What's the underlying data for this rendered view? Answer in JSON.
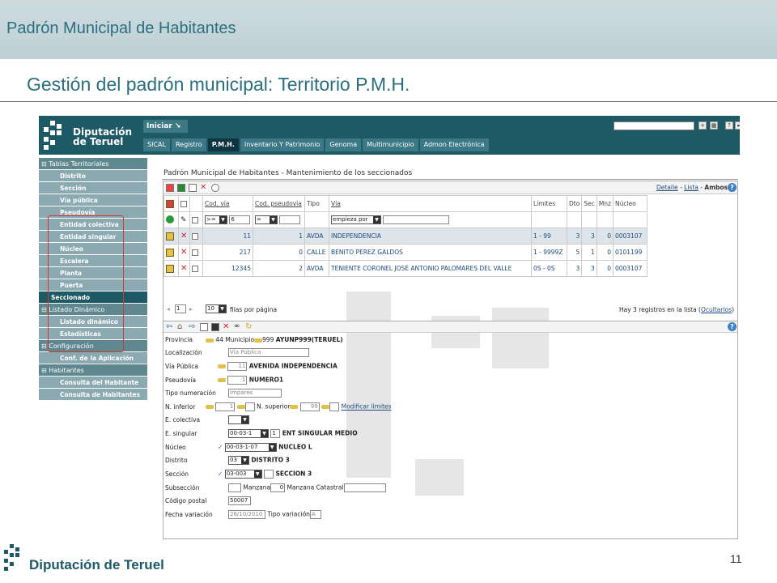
{
  "header": {
    "title": "Padrón Municipal de Habitantes"
  },
  "slide": {
    "title": "Gestión del padrón municipal: Territorio P.M.H.",
    "page_number": "11",
    "footer_brand": "Diputación de Teruel"
  },
  "app": {
    "logo_line1": "Diputación",
    "logo_line2": "de Teruel",
    "start_button": "Iniciar ↘",
    "tabs": [
      "SICAL",
      "Registro",
      "P.M.H.",
      "Inventario Y Patrimonio",
      "Genoma",
      "Multimunicipio",
      "Admon Electrónica"
    ],
    "active_tab": "P.M.H."
  },
  "sidebar": {
    "group1": "Tablas Territoriales",
    "items1": [
      "Distrito",
      "Sección",
      "Vía pública",
      "Pseudovía",
      "Entidad colectiva",
      "Entidad singular",
      "Núcleo",
      "Escalera",
      "Planta",
      "Puerta"
    ],
    "selected": "Seccionado",
    "group2": "Listado Dinámico",
    "items2": [
      "Listado dinámico",
      "Estadísticas"
    ],
    "group3": "Configuración",
    "items3": [
      "Conf. de la Aplicación"
    ],
    "group4": "Habitantes",
    "items4": [
      "Consulta del Habitante",
      "Consulta de Habitantes"
    ]
  },
  "panel": {
    "title": "Padrón Municipal de Habitantes - Mantenimiento de los seccionados",
    "views": {
      "detalle": "Detalle",
      "lista": "Lista",
      "ambos": "Ambos",
      "sep": "-"
    },
    "columns": {
      "cod_via": "Cod. vía",
      "cod_pseudovia": "Cod. pseudovía",
      "tipo": "Tipo",
      "via": "Vía",
      "limites": "Límites",
      "dto": "Dto",
      "sec": "Sec",
      "mnz": "Mnz",
      "nucleo": "Núcleo"
    },
    "filters": {
      "op1": ">=",
      "val1": "6",
      "op2": "=",
      "via_mode": "empieza por"
    },
    "rows": [
      {
        "cod_via": "11",
        "cod_pseudovia": "1",
        "tipo": "AVDA",
        "via": "INDEPENDENCIA",
        "limites": "1 - 99",
        "dto": "3",
        "sec": "3",
        "mnz": "0",
        "nucleo": "0003107"
      },
      {
        "cod_via": "217",
        "cod_pseudovia": "0",
        "tipo": "CALLE",
        "via": "BENITO PEREZ GALDOS",
        "limites": "1 - 9999Z",
        "dto": "5",
        "sec": "1",
        "mnz": "0",
        "nucleo": "0101199"
      },
      {
        "cod_via": "12345",
        "cod_pseudovia": "2",
        "tipo": "AVDA",
        "via": "TENIENTE CORONEL JOSÉ ANTONIO PALOMARES DEL VALLE",
        "limites": "0S - 0S",
        "dto": "3",
        "sec": "3",
        "mnz": "0",
        "nucleo": "0003107"
      }
    ],
    "pager": {
      "page": "1",
      "page_size": "10",
      "per_page_label": "filas por página",
      "count_text": "Hay 3 registros en la lista (",
      "hidden_link": "Ocultarlos",
      "count_close": ")"
    }
  },
  "form": {
    "provincia_label": "Provincia",
    "provincia_code": "44",
    "municipio_label": "Municipio",
    "municipio_code": "999",
    "municipio_name": "AYUNP999(TERUEL)",
    "localizacion_label": "Localización",
    "localizacion_value": "Vía Pública",
    "via_label": "Vía Pública",
    "via_code": "11",
    "via_name": "AVENIDA INDEPENDENCIA",
    "pseudovia_label": "Pseudovía",
    "pseudovia_code": "1",
    "pseudovia_name": "NUMERO1",
    "tiponum_label": "Tipo numeración",
    "tiponum_value": "Impares",
    "ninf_label": "N. inferior",
    "ninf_value": "1",
    "nsup_label": "N. superior",
    "nsup_value": "99",
    "mod_link": "Modificar límites",
    "ecol_label": "E. colectiva",
    "esing_label": "E. singular",
    "esing_value": "00-03-1",
    "esing_code": "1",
    "esing_name": "ENT SINGULAR MEDIO",
    "nucleo_label": "Núcleo",
    "nucleo_value": "00-03-1-07",
    "nucleo_name": "NUCLEO L",
    "distrito_label": "Distrito",
    "distrito_value": "03",
    "distrito_name": "DISTRITO 3",
    "seccion_label": "Sección",
    "seccion_value": "03-003",
    "seccion_name": "SECCION 3",
    "subseccion_label": "Subsección",
    "manzana_label": "Manzana",
    "manzana_value": "0",
    "manzana_cat_label": "Manzana Catastral",
    "cp_label": "Código postal",
    "cp_value": "50007",
    "fecha_label": "Fecha variación",
    "fecha_value": "26/10/2010",
    "tipovar_label": "Tipo variación",
    "tipovar_value": "A"
  }
}
